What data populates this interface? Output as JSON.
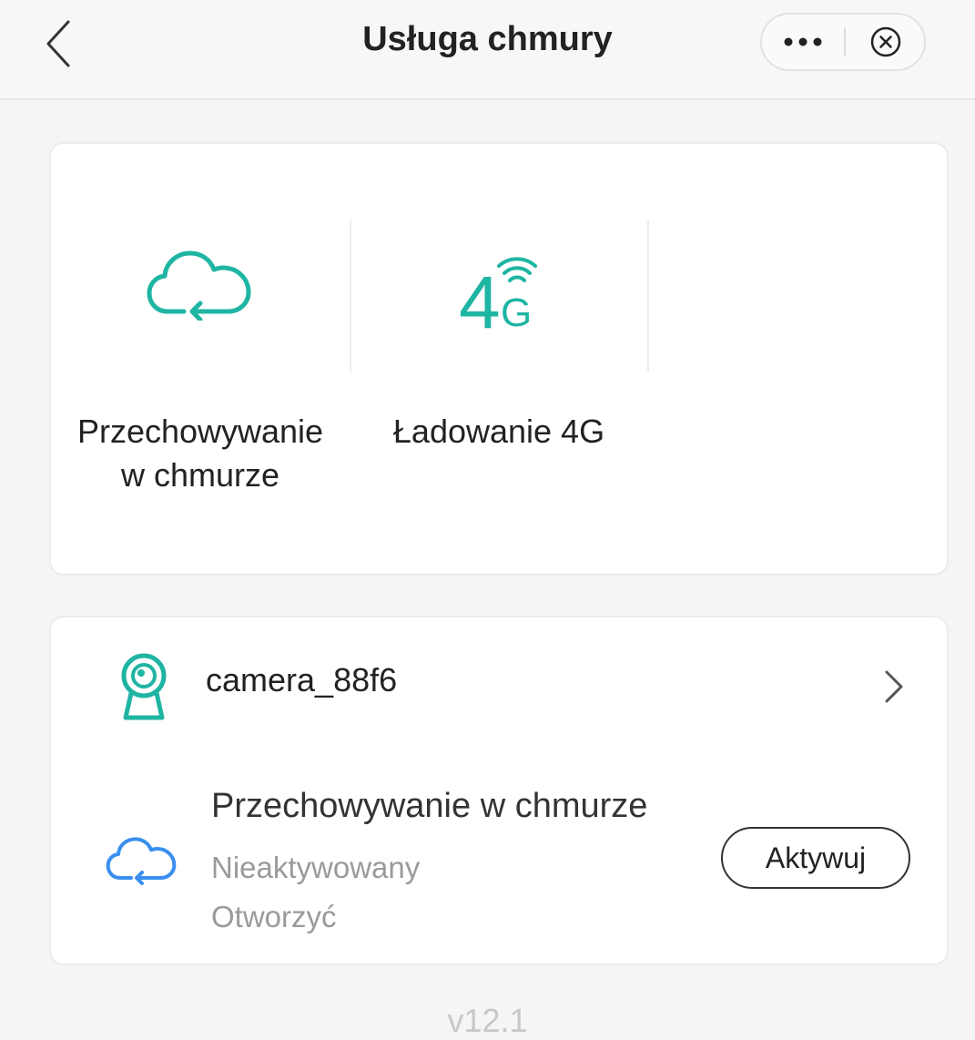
{
  "header": {
    "title": "Usługa chmury",
    "back_icon": "chevron-left-icon",
    "more_icon": "more-dots-icon",
    "close_icon": "close-circle-icon"
  },
  "services": [
    {
      "label_line1": "Przechowywanie",
      "label_line2": "w chmurze",
      "icon": "cloud-sync-icon"
    },
    {
      "label_line1": "Ładowanie 4G",
      "label_line2": "",
      "icon": "4g-signal-icon"
    }
  ],
  "device": {
    "name": "camera_88f6",
    "icon": "camera-icon",
    "plan": {
      "title": "Przechowywanie w chmurze",
      "status": "Nieaktywowany",
      "action_hint": "Otworzyć",
      "button_label": "Aktywuj",
      "icon": "cloud-sync-icon"
    }
  },
  "footer": {
    "version": "v12.1"
  },
  "colors": {
    "accent": "#1fb5a3",
    "plan_icon": "#3a8ff0",
    "background": "#f5f5f5"
  }
}
